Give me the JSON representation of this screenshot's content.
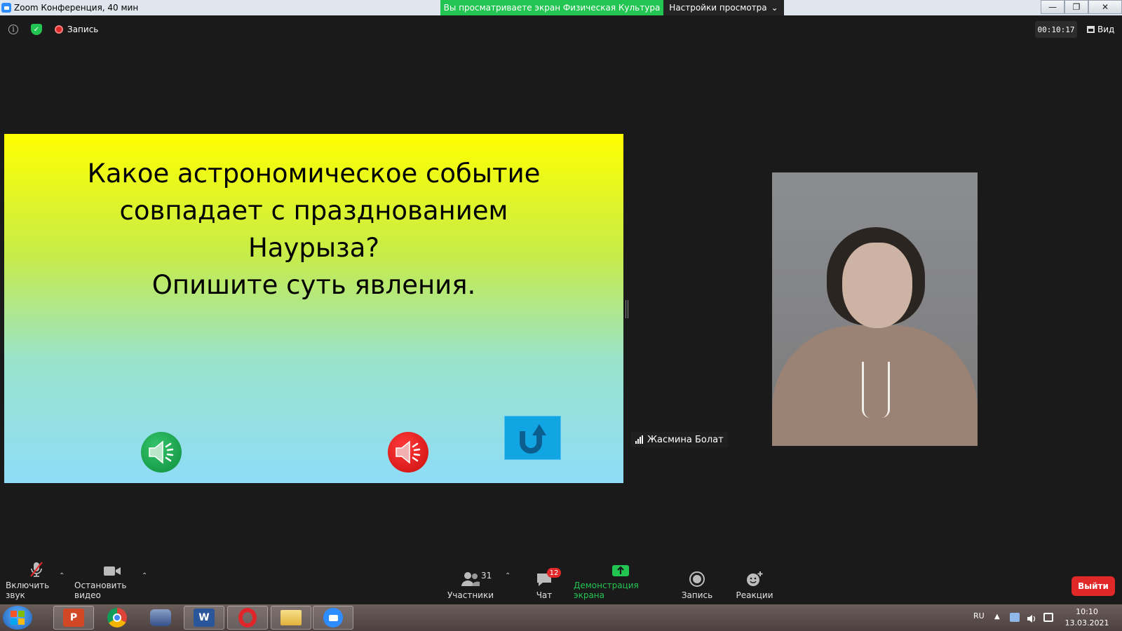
{
  "window": {
    "title": "Zoom Конференция, 40 мин",
    "share_banner": "Вы просматриваете экран Физическая Культура",
    "view_settings": "Настройки просмотра",
    "controls": {
      "minimize": "—",
      "maximize": "❐",
      "close": "✕"
    }
  },
  "topbar": {
    "recording_label": "Запись",
    "timer": "00:10:17",
    "view_label": "Вид"
  },
  "slide": {
    "question_lines": [
      "Какое астрономическое событие",
      "совпадает с празднованием",
      "Наурыза?",
      "Опишите суть явления."
    ],
    "colors": {
      "top": "#ffff00",
      "bottom": "#8fdcf8"
    }
  },
  "participant": {
    "name": "Жасмина Болат"
  },
  "toolbar": {
    "mute": "Включить звук",
    "video": "Остановить видео",
    "participants": "Участники",
    "participants_count": "31",
    "chat": "Чат",
    "chat_badge": "12",
    "share": "Демонстрация экрана",
    "record": "Запись",
    "reactions": "Реакции",
    "leave": "Выйти"
  },
  "taskbar": {
    "language": "RU",
    "time": "10:10",
    "date": "13.03.2021"
  },
  "colors": {
    "share_green": "#23c552",
    "leave_red": "#e02828",
    "zoom_blue": "#2d8cff"
  }
}
